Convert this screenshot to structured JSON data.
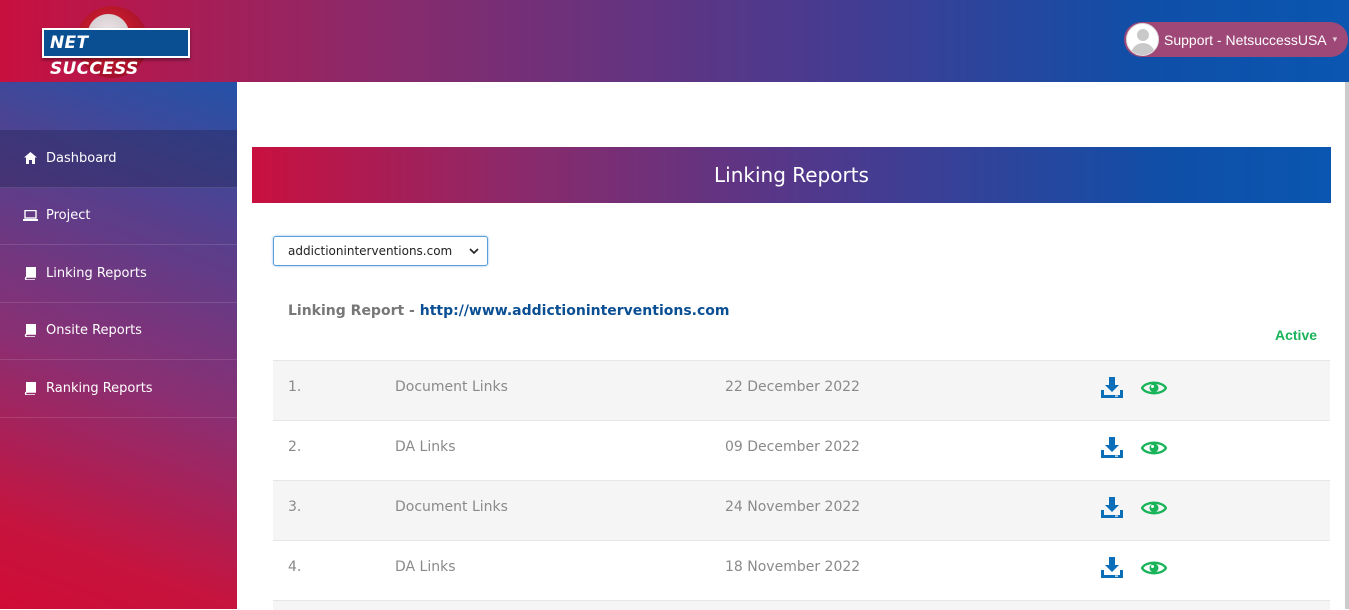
{
  "header": {
    "logo_text": "NET SUCCESS",
    "user_name": "Support - NetsuccessUSA",
    "caret": "▾"
  },
  "sidebar": {
    "items": [
      {
        "label": "Dashboard",
        "icon": "home-icon",
        "active": true
      },
      {
        "label": "Project",
        "icon": "laptop-icon",
        "active": false
      },
      {
        "label": "Linking Reports",
        "icon": "book-icon",
        "active": false
      },
      {
        "label": "Onsite Reports",
        "icon": "book-icon",
        "active": false
      },
      {
        "label": "Ranking Reports",
        "icon": "book-icon",
        "active": false
      }
    ]
  },
  "main": {
    "banner_title": "Linking Reports",
    "domain_select": {
      "value": "addictioninterventions.com"
    },
    "report_label": "Linking Report - ",
    "report_url": "http://www.addictioninterventions.com",
    "status": "Active",
    "rows": [
      {
        "num": "1.",
        "type": "Document Links",
        "date": "22 December 2022"
      },
      {
        "num": "2.",
        "type": "DA Links",
        "date": "09 December 2022"
      },
      {
        "num": "3.",
        "type": "Document Links",
        "date": "24 November 2022"
      },
      {
        "num": "4.",
        "type": "DA Links",
        "date": "18 November 2022"
      }
    ]
  },
  "colors": {
    "download_icon": "#0a6fb8",
    "view_icon": "#19b35a",
    "status_active": "#19b35a",
    "link": "#0a4f93"
  }
}
